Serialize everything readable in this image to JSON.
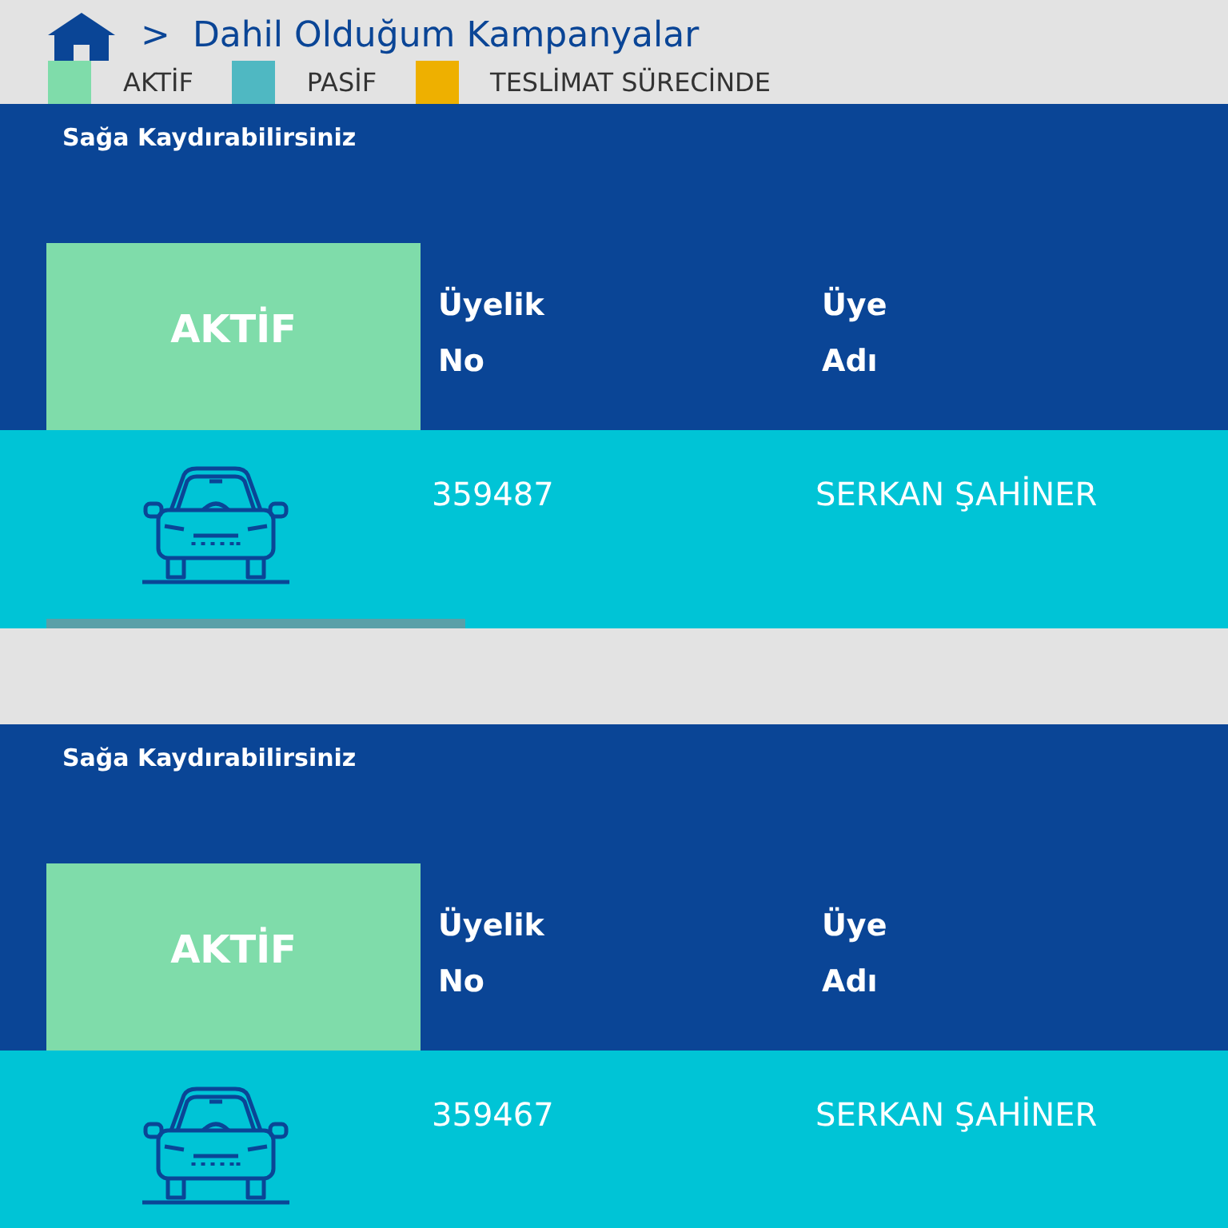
{
  "breadcrumb": {
    "separator": ">",
    "title": "Dahil Olduğum Kampanyalar"
  },
  "legend": [
    {
      "label": "AKTİF",
      "color": "#7fdcaa"
    },
    {
      "label": "PASİF",
      "color": "#4fb8c2"
    },
    {
      "label": "TESLİMAT SÜRECİNDE",
      "color": "#eeb000"
    }
  ],
  "campaigns": [
    {
      "hint": "Sağa Kaydırabilirsiniz",
      "status": "AKTİF",
      "color": "#7fdcaa",
      "columns": [
        "Üyelik\nNo",
        "Üye\nAdı"
      ],
      "values": [
        "359487",
        "SERKAN ŞAHİNER"
      ]
    },
    {
      "hint": "Sağa Kaydırabilirsiniz",
      "status": "AKTİF",
      "color": "#7fdcaa",
      "columns": [
        "Üyelik\nNo",
        "Üye\nAdı"
      ],
      "values": [
        "359467",
        "SERKAN ŞAHİNER"
      ]
    }
  ]
}
